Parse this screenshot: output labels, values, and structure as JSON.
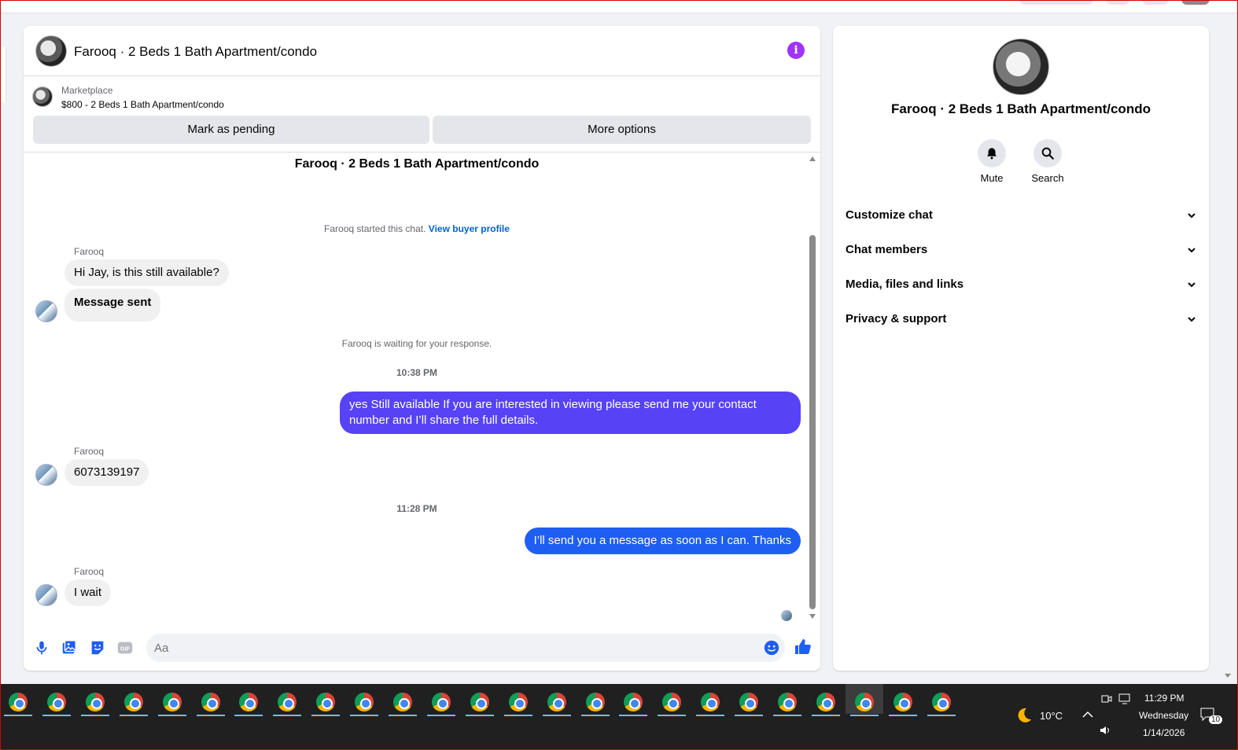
{
  "chat": {
    "title": "Farooq · 2 Beds 1 Bath Apartment/condo",
    "marketplace_label": "Marketplace",
    "marketplace_item": "$800 - 2 Beds 1 Bath Apartment/condo",
    "mark_pending_label": "Mark as pending",
    "more_options_label": "More options",
    "conversation_title": "Farooq · 2 Beds 1 Bath Apartment/condo",
    "started_text": "Farooq started this chat.",
    "view_buyer_profile": "View buyer profile",
    "messages": [
      {
        "sender": "Farooq",
        "text": "Hi Jay, is this still available?"
      },
      {
        "text": "Message sent"
      },
      {
        "status": "Farooq is waiting for your response."
      },
      {
        "timestamp": "10:38 PM"
      },
      {
        "outgoing": "yes Still available If you are interested in viewing please send me your contact number and I’ll share the full details."
      },
      {
        "sender": "Farooq",
        "text": "6073139197"
      },
      {
        "timestamp": "11:28 PM"
      },
      {
        "outgoing": "I’ll send you a message as soon as I can. Thanks"
      },
      {
        "sender": "Farooq",
        "text": "I wait"
      }
    ],
    "composer_placeholder": "Aa"
  },
  "info_panel": {
    "name": "Farooq · 2 Beds 1 Bath Apartment/condo",
    "actions": [
      "Mute",
      "Search"
    ],
    "sections": [
      "Customize chat",
      "Chat members",
      "Media, files and links",
      "Privacy & support"
    ]
  },
  "taskbar": {
    "temperature": "10°C",
    "time": "11:29 PM",
    "day": "Wednesday",
    "date": "1/14/2026",
    "notifications": "10"
  },
  "colors": {
    "accent": "#1f5ef2",
    "outgoing_bubble": "#5643f5",
    "info_icon": "#a033ff",
    "link": "#0064d1"
  }
}
